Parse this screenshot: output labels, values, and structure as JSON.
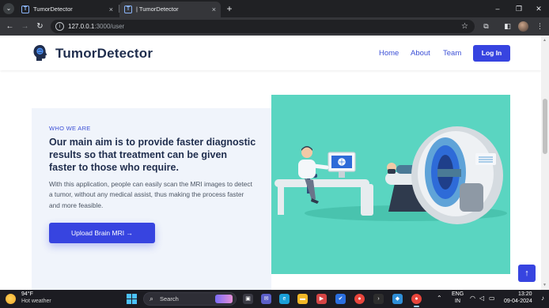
{
  "browser": {
    "tabs": [
      {
        "favicon": "T",
        "title": "TumorDetector",
        "close": "×"
      },
      {
        "favicon": "T",
        "title": "| TumorDetector",
        "close": "×"
      }
    ],
    "new_tab": "+",
    "window_controls": {
      "minimize": "–",
      "maximize": "❐",
      "close": "✕"
    },
    "url_host": "127.0.0.1",
    "url_path": ":3000/user"
  },
  "site": {
    "brand": "TumorDetector",
    "nav": [
      "Home",
      "About",
      "Team"
    ],
    "login": "Log In"
  },
  "hero": {
    "eyebrow": "WHO WE ARE",
    "headline": "Our main aim is to provide faster diagnostic results so that treatment can be given faster to those who require.",
    "paragraph": "With this application, people can easily scan the MRI images to detect a tumor, without any medical assist, thus making the process faster and more feasible.",
    "upload_button": "Upload Brain MRI →",
    "illustration_bg": "#5ad5c1"
  },
  "back_to_top": "↑",
  "taskbar": {
    "weather_temp": "94°F",
    "weather_desc": "Hot weather",
    "search_placeholder": "Search",
    "language": "ENG",
    "region": "IN",
    "time": "13:20",
    "date": "09-04-2024"
  },
  "colors": {
    "accent": "#3744e0",
    "heading": "#1f2d4d",
    "hero_panel": "#f0f4fb",
    "illustration": "#5ad5c1"
  }
}
